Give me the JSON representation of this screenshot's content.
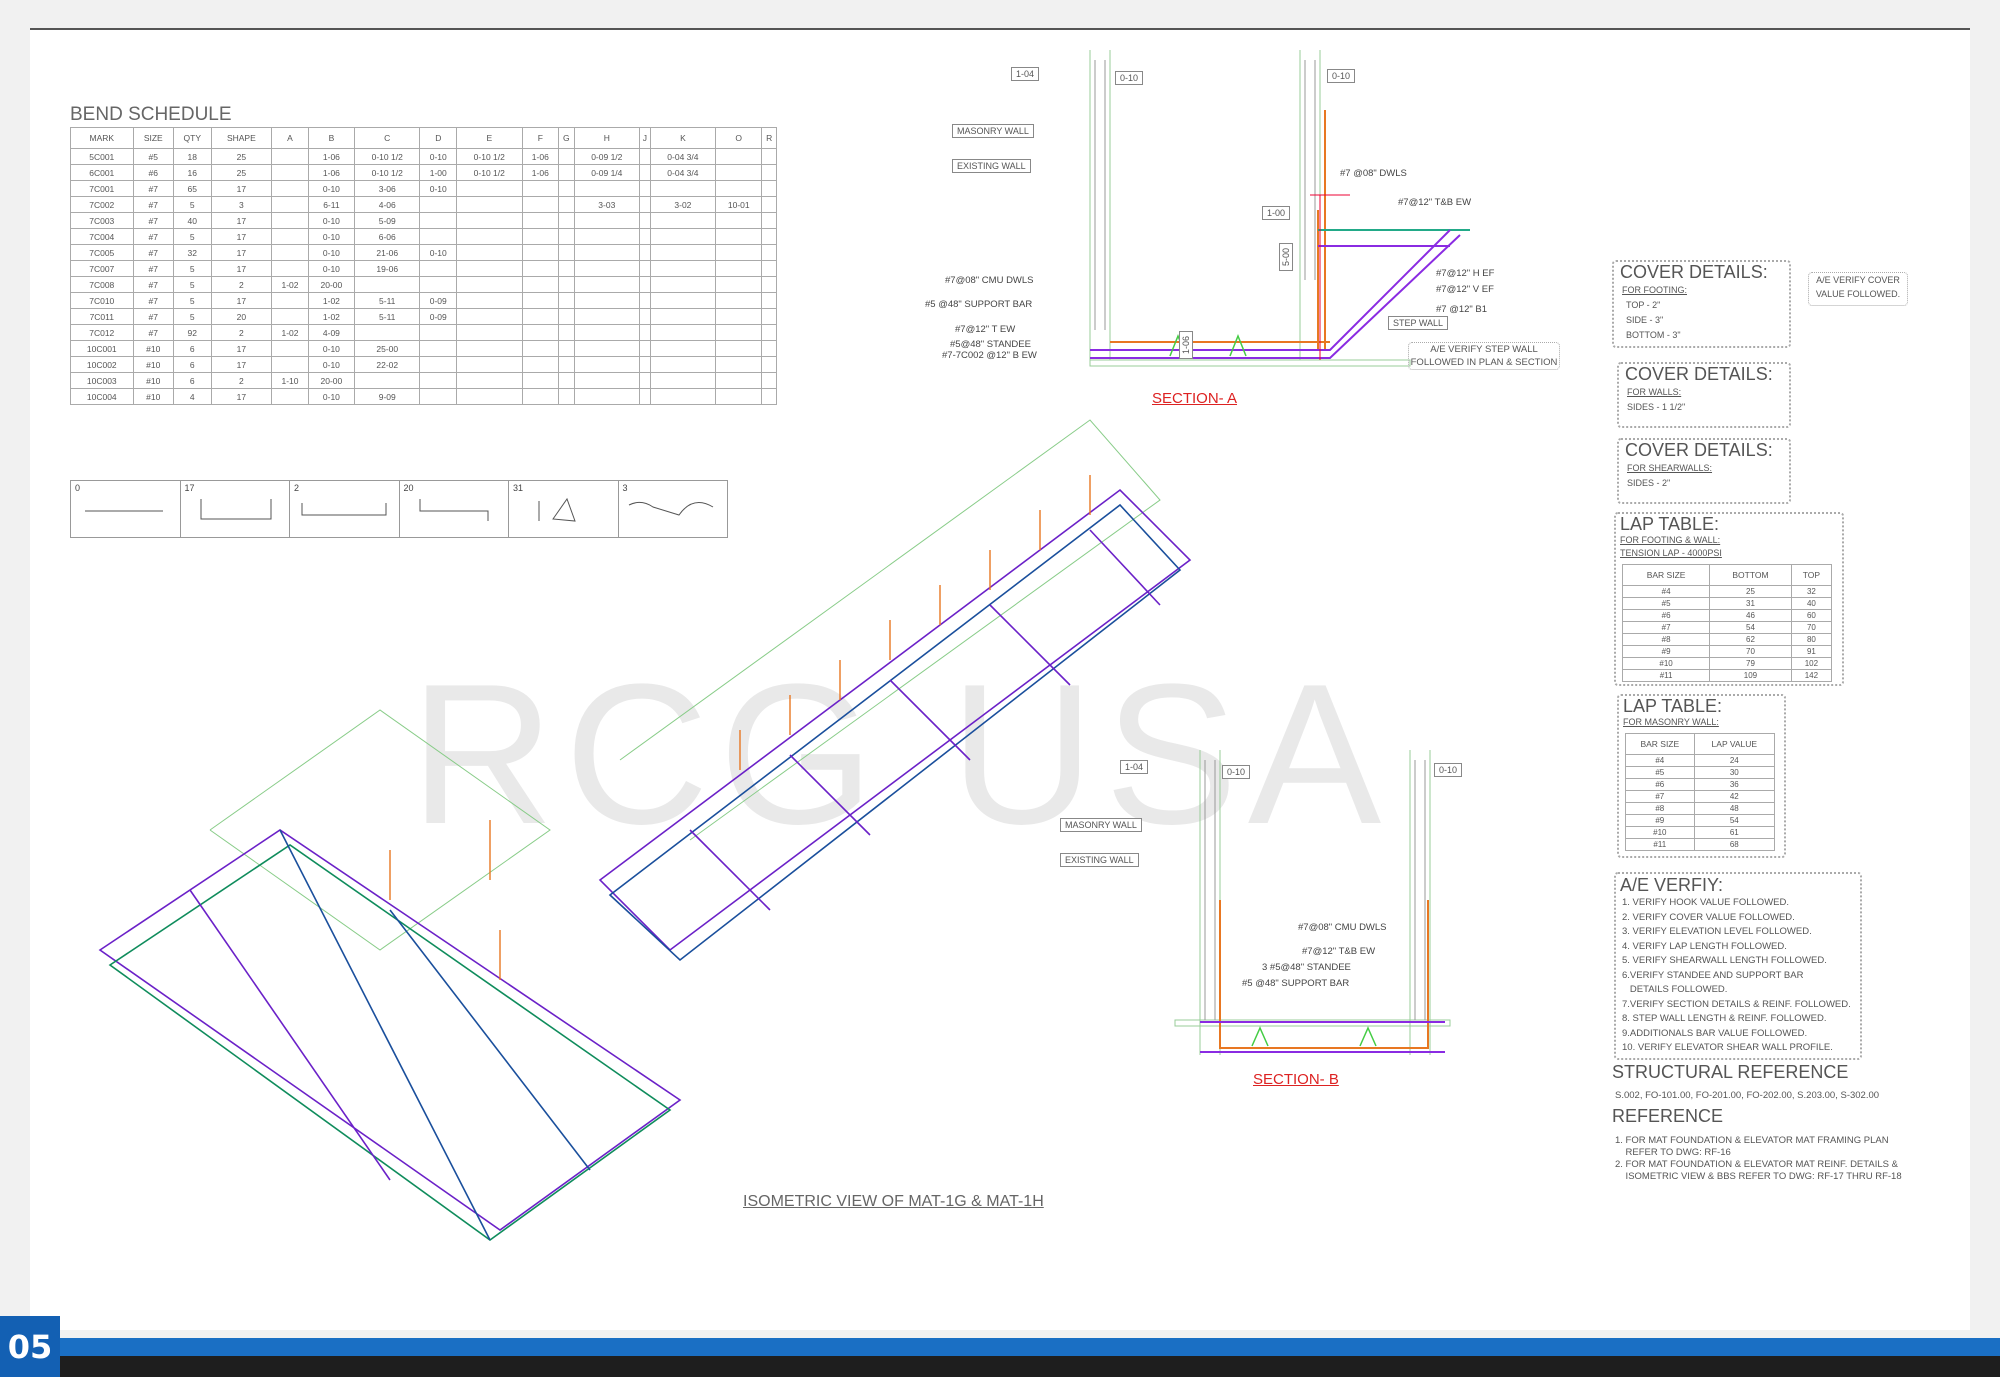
{
  "bend_schedule": {
    "title": "BEND SCHEDULE",
    "headers": [
      "MARK",
      "SIZE",
      "QTY",
      "SHAPE",
      "A",
      "B",
      "C",
      "D",
      "E",
      "F",
      "G",
      "H",
      "J",
      "K",
      "O",
      "R"
    ],
    "rows": [
      [
        "5C001",
        "#5",
        "18",
        "25",
        "",
        "1-06",
        "0-10 1/2",
        "0-10",
        "0-10 1/2",
        "1-06",
        "",
        "0-09 1/2",
        "",
        "0-04 3/4",
        "",
        ""
      ],
      [
        "6C001",
        "#6",
        "16",
        "25",
        "",
        "1-06",
        "0-10 1/2",
        "1-00",
        "0-10 1/2",
        "1-06",
        "",
        "0-09 1/4",
        "",
        "0-04 3/4",
        "",
        ""
      ],
      [
        "7C001",
        "#7",
        "65",
        "17",
        "",
        "0-10",
        "3-06",
        "0-10",
        "",
        "",
        "",
        "",
        "",
        "",
        "",
        ""
      ],
      [
        "7C002",
        "#7",
        "5",
        "3",
        "",
        "6-11",
        "4-06",
        "",
        "",
        "",
        "",
        "3-03",
        "",
        "3-02",
        "10-01",
        ""
      ],
      [
        "7C003",
        "#7",
        "40",
        "17",
        "",
        "0-10",
        "5-09",
        "",
        "",
        "",
        "",
        "",
        "",
        "",
        "",
        ""
      ],
      [
        "7C004",
        "#7",
        "5",
        "17",
        "",
        "0-10",
        "6-06",
        "",
        "",
        "",
        "",
        "",
        "",
        "",
        "",
        ""
      ],
      [
        "7C005",
        "#7",
        "32",
        "17",
        "",
        "0-10",
        "21-06",
        "0-10",
        "",
        "",
        "",
        "",
        "",
        "",
        "",
        ""
      ],
      [
        "7C007",
        "#7",
        "5",
        "17",
        "",
        "0-10",
        "19-06",
        "",
        "",
        "",
        "",
        "",
        "",
        "",
        "",
        ""
      ],
      [
        "7C008",
        "#7",
        "5",
        "2",
        "1-02",
        "20-00",
        "",
        "",
        "",
        "",
        "",
        "",
        "",
        "",
        "",
        ""
      ],
      [
        "7C010",
        "#7",
        "5",
        "17",
        "",
        "1-02",
        "5-11",
        "0-09",
        "",
        "",
        "",
        "",
        "",
        "",
        "",
        ""
      ],
      [
        "7C011",
        "#7",
        "5",
        "20",
        "",
        "1-02",
        "5-11",
        "0-09",
        "",
        "",
        "",
        "",
        "",
        "",
        "",
        ""
      ],
      [
        "7C012",
        "#7",
        "92",
        "2",
        "1-02",
        "4-09",
        "",
        "",
        "",
        "",
        "",
        "",
        "",
        "",
        "",
        ""
      ],
      [
        "10C001",
        "#10",
        "6",
        "17",
        "",
        "0-10",
        "25-00",
        "",
        "",
        "",
        "",
        "",
        "",
        "",
        "",
        ""
      ],
      [
        "10C002",
        "#10",
        "6",
        "17",
        "",
        "0-10",
        "22-02",
        "",
        "",
        "",
        "",
        "",
        "",
        "",
        "",
        ""
      ],
      [
        "10C003",
        "#10",
        "6",
        "2",
        "1-10",
        "20-00",
        "",
        "",
        "",
        "",
        "",
        "",
        "",
        "",
        "",
        ""
      ],
      [
        "10C004",
        "#10",
        "4",
        "17",
        "",
        "0-10",
        "9-09",
        "",
        "",
        "",
        "",
        "",
        "",
        "",
        "",
        ""
      ]
    ]
  },
  "shapes": [
    "0",
    "17",
    "2",
    "20",
    "31",
    "3"
  ],
  "section_a": {
    "title": "SECTION- A",
    "labels": [
      "MASONRY WALL",
      "EXISTING WALL",
      "#7@08\" CMU DWLS",
      "#5 @48\" SUPPORT BAR",
      "#7@12\" T EW",
      "#5@48\" STANDEE",
      "#7-7C002 @12\" B EW",
      "#7 @08\" DWLS",
      "#7@12\" T&B EW",
      "#7@12\" H EF",
      "#7@12\" V EF",
      "#7 @12\" B1",
      "STEP WALL"
    ],
    "dims": [
      "1-04",
      "0-10",
      "0-10",
      "1-00",
      "5-00",
      "1-06"
    ],
    "note": [
      "A/E VERIFY STEP WALL",
      "FOLLOWED IN PLAN & SECTION"
    ]
  },
  "section_b": {
    "title": "SECTION- B",
    "labels": [
      "MASONRY WALL",
      "EXISTING WALL",
      "#7@08\" CMU DWLS",
      "#7@12\" T&B EW",
      "3 #5@48\" STANDEE",
      "#5 @48\" SUPPORT BAR"
    ],
    "dims": [
      "1-04",
      "0-10",
      "0-10"
    ]
  },
  "iso_title": "ISOMETRIC VIEW OF MAT-1G & MAT-1H",
  "cover_footing": {
    "title": "COVER DETAILS:",
    "sub": "FOR FOOTING:",
    "lines": [
      "TOP - 2\"",
      "SIDE - 3\"",
      "BOTTOM - 3\""
    ]
  },
  "cover_note": [
    "A/E VERIFY COVER",
    "VALUE FOLLOWED."
  ],
  "cover_walls": {
    "title": "COVER DETAILS:",
    "sub": "FOR WALLS:",
    "lines": [
      "SIDES - 1 1/2\""
    ]
  },
  "cover_shear": {
    "title": "COVER DETAILS:",
    "sub": "FOR SHEARWALLS:",
    "lines": [
      "SIDES - 2\""
    ]
  },
  "lap1": {
    "title": "LAP TABLE:",
    "sub1": "FOR FOOTING & WALL:",
    "sub2": "TENSION LAP - 4000PSI",
    "headers": [
      "BAR SIZE",
      "BOTTOM",
      "TOP"
    ],
    "rows": [
      [
        "#4",
        "25",
        "32"
      ],
      [
        "#5",
        "31",
        "40"
      ],
      [
        "#6",
        "46",
        "60"
      ],
      [
        "#7",
        "54",
        "70"
      ],
      [
        "#8",
        "62",
        "80"
      ],
      [
        "#9",
        "70",
        "91"
      ],
      [
        "#10",
        "79",
        "102"
      ],
      [
        "#11",
        "109",
        "142"
      ]
    ]
  },
  "lap2": {
    "title": "LAP TABLE:",
    "sub1": "FOR MASONRY WALL:",
    "headers": [
      "BAR SIZE",
      "LAP VALUE"
    ],
    "rows": [
      [
        "#4",
        "24"
      ],
      [
        "#5",
        "30"
      ],
      [
        "#6",
        "36"
      ],
      [
        "#7",
        "42"
      ],
      [
        "#8",
        "48"
      ],
      [
        "#9",
        "54"
      ],
      [
        "#10",
        "61"
      ],
      [
        "#11",
        "68"
      ]
    ]
  },
  "ae_verify": {
    "title": "A/E VERFIY:",
    "items": [
      "1. VERIFY HOOK VALUE FOLLOWED.",
      "2. VERIFY COVER VALUE FOLLOWED.",
      "3. VERIFY ELEVATION LEVEL FOLLOWED.",
      "4. VERIFY LAP LENGTH FOLLOWED.",
      "5. VERIFY SHEARWALL LENGTH FOLLOWED.",
      "6.VERIFY STANDEE AND SUPPORT BAR",
      "   DETAILS FOLLOWED.",
      "7.VERIFY SECTION DETAILS & REINF. FOLLOWED.",
      "8. STEP WALL LENGTH & REINF. FOLLOWED.",
      "9.ADDITIONALS BAR VALUE FOLLOWED.",
      "10. VERIFY ELEVATOR SHEAR WALL PROFILE."
    ]
  },
  "struct_ref": {
    "title": "STRUCTURAL REFERENCE",
    "text": "S.002, FO-101.00, FO-201.00, FO-202.00, S.203.00, S-302.00"
  },
  "reference": {
    "title": "REFERENCE",
    "items": [
      "1. FOR MAT FOUNDATION & ELEVATOR MAT FRAMING PLAN",
      "    REFER TO DWG: RF-16",
      "2. FOR MAT FOUNDATION & ELEVATOR MAT REINF. DETAILS &",
      "    ISOMETRIC VIEW & BBS REFER TO DWG: RF-17 THRU RF-18"
    ]
  },
  "watermark": "RCG USA",
  "page_number": "05"
}
